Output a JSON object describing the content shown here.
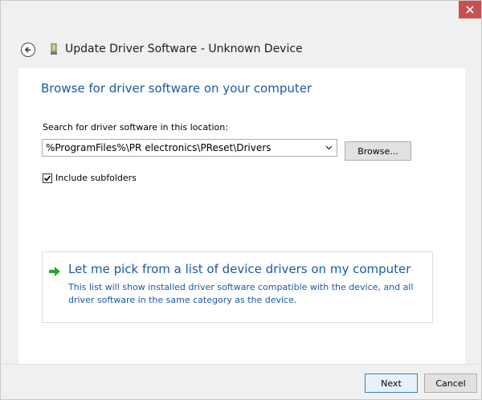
{
  "window": {
    "title": "Update Driver Software - Unknown Device"
  },
  "icons": {
    "close": "close-icon",
    "back": "back-arrow-icon",
    "device": "device-icon",
    "pick": "green-arrow-icon",
    "dropdown": "chevron-down-icon",
    "check": "checkmark-icon"
  },
  "colors": {
    "heading_blue": "#1a5aa6",
    "close_red": "#c75050",
    "arrow_green": "#2aa52a"
  },
  "main": {
    "heading": "Browse for driver software on your computer",
    "search_label": "Search for driver software in this location:",
    "path_value": "%ProgramFiles%\\PR electronics\\PReset\\Drivers",
    "browse_label": "Browse...",
    "include_subfolders_label": "Include subfolders",
    "include_subfolders_checked": true,
    "pick": {
      "title": "Let me pick from a list of device drivers on my computer",
      "description": "This list will show installed driver software compatible with the device, and all driver software in the same category as the device."
    }
  },
  "footer": {
    "next_label": "Next",
    "cancel_label": "Cancel"
  }
}
